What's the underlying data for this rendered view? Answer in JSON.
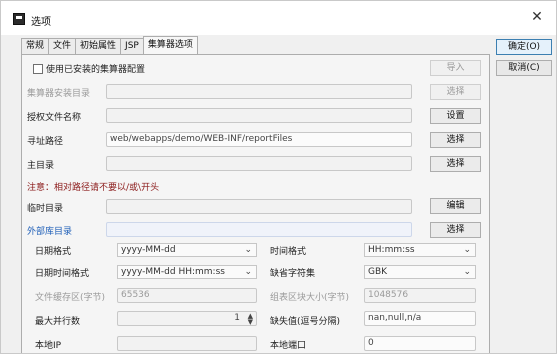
{
  "window": {
    "title": "选项",
    "close_glyph": "✕"
  },
  "tabs": [
    {
      "label": "常规"
    },
    {
      "label": "文件"
    },
    {
      "label": "初始属性"
    },
    {
      "label": "JSP"
    },
    {
      "label": "集算器选项",
      "active": true
    }
  ],
  "side_buttons": {
    "ok": "确定(O)",
    "cancel": "取消(C)"
  },
  "panel": {
    "use_installed_label": "使用已安装的集算器配置",
    "use_installed_checked": false,
    "import_button": "导入",
    "install_dir_label": "集算器安装目录",
    "install_dir_value": "",
    "install_dir_button": "选择",
    "license_label": "授权文件名称",
    "license_value": "",
    "license_button": "设置",
    "search_path_label": "寻址路径",
    "search_path_value": "web/webapps/demo/WEB-INF/reportFiles",
    "search_path_button": "选择",
    "main_dir_label": "主目录",
    "main_dir_value": "",
    "main_dir_button": "选择",
    "notice": "注意：相对路径请不要以/或\\开头",
    "temp_dir_label": "临时目录",
    "temp_dir_value": "",
    "temp_dir_button": "编辑",
    "ext_lib_label": "外部库目录",
    "ext_lib_value": "",
    "ext_lib_button": "选择",
    "date_format_label": "日期格式",
    "date_format_value": "yyyy-MM-dd",
    "time_format_label": "时间格式",
    "time_format_value": "HH:mm:ss",
    "datetime_format_label": "日期时间格式",
    "datetime_format_value": "yyyy-MM-dd HH:mm:ss",
    "charset_label": "缺省字符集",
    "charset_value": "GBK",
    "file_buffer_label": "文件缓存区(字节)",
    "file_buffer_value": "65536",
    "block_size_label": "组表区块大小(字节)",
    "block_size_value": "1048576",
    "max_parallel_label": "最大并行数",
    "max_parallel_value": "1",
    "null_values_label": "缺失值(逗号分隔)",
    "null_values_value": "nan,null,n/a",
    "local_ip_label": "本地IP",
    "local_ip_value": "",
    "local_port_label": "本地端口",
    "local_port_value": "0"
  },
  "icons": {
    "dropdown": "⌄",
    "spin_up": "▲",
    "spin_down": "▼"
  }
}
